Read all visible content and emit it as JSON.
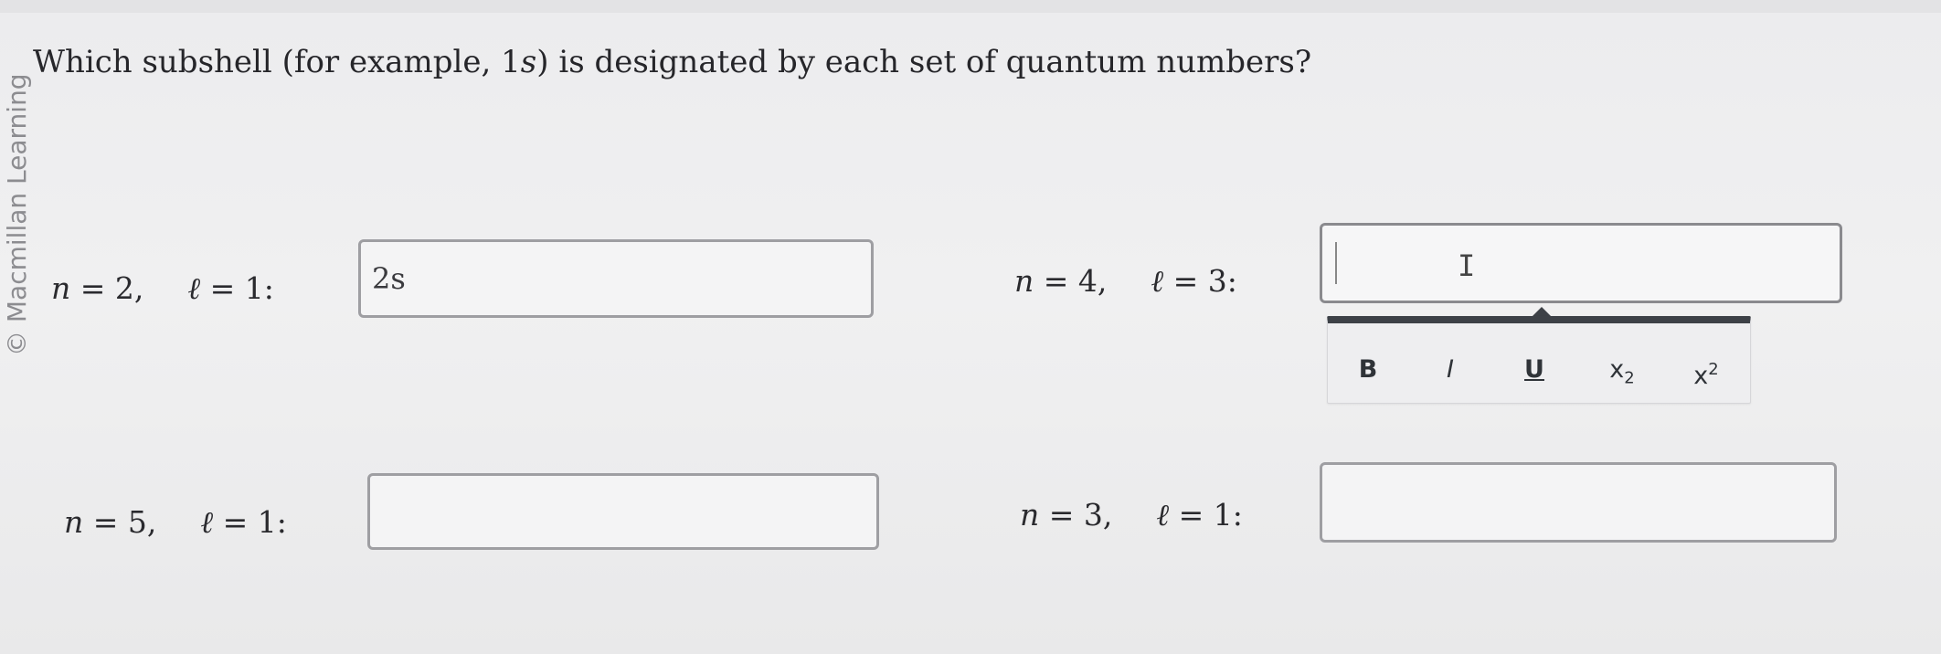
{
  "watermark": "© Macmillan Learning",
  "question": {
    "prefix": "Which subshell (for example, 1",
    "example_var": "s",
    "suffix": ") is designated by each set of quantum numbers?"
  },
  "items": [
    {
      "n_sym": "n",
      "n_val": " = 2,",
      "l_sym": "ℓ",
      "l_val": " = 1:",
      "answer": "2s"
    },
    {
      "n_sym": "n",
      "n_val": " = 4,",
      "l_sym": "ℓ",
      "l_val": " = 3:",
      "answer": ""
    },
    {
      "n_sym": "n",
      "n_val": " = 5,",
      "l_sym": "ℓ",
      "l_val": " = 1:",
      "answer": ""
    },
    {
      "n_sym": "n",
      "n_val": " = 3,",
      "l_sym": "ℓ",
      "l_val": " = 1:",
      "answer": ""
    }
  ],
  "cursor_glyph": "I",
  "toolbar": {
    "bold": "B",
    "italic": "I",
    "underline": "U",
    "subscript_base": "x",
    "subscript_mark": "2",
    "superscript_base": "x",
    "superscript_mark": "2"
  },
  "colors": {
    "toolbar_bar": "#3d4147",
    "input_border": "#9e9ea2"
  }
}
